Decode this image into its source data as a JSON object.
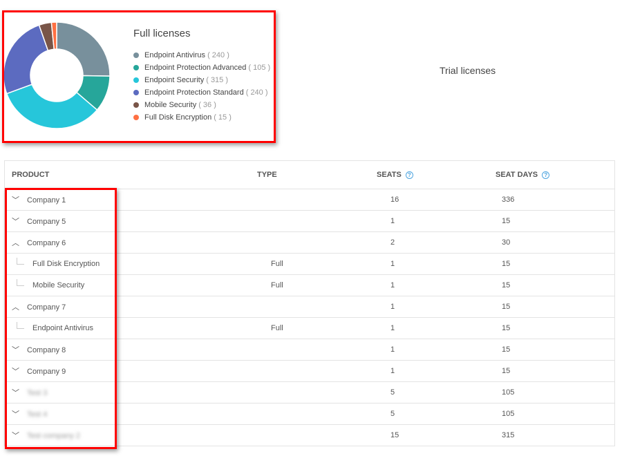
{
  "chart_data": {
    "type": "pie",
    "title": "Full licenses",
    "donut": true,
    "slices": [
      {
        "name": "Endpoint Antivirus",
        "value": 240,
        "color": "#78909c"
      },
      {
        "name": "Endpoint Protection Advanced",
        "value": 105,
        "color": "#26a69a"
      },
      {
        "name": "Endpoint Security",
        "value": 315,
        "color": "#26c6da"
      },
      {
        "name": "Endpoint Protection Standard",
        "value": 240,
        "color": "#5c6bc0"
      },
      {
        "name": "Mobile Security",
        "value": 36,
        "color": "#795548"
      },
      {
        "name": "Full Disk Encryption",
        "value": 15,
        "color": "#ff7043"
      }
    ],
    "legend": "right"
  },
  "legend_counts": [
    "( 240 )",
    "( 105 )",
    "( 315 )",
    "( 240 )",
    "( 36 )",
    "( 15 )"
  ],
  "trial_title": "Trial licenses",
  "table": {
    "headers": {
      "product": "PRODUCT",
      "type": "TYPE",
      "seats": "SEATS",
      "seat_days": "SEAT DAYS",
      "help": "?"
    },
    "rows": [
      {
        "kind": "parent",
        "expanded": false,
        "product": "Company 1",
        "type": "",
        "seats": "16",
        "seat_days": "336"
      },
      {
        "kind": "parent",
        "expanded": false,
        "product": "Company 5",
        "type": "",
        "seats": "1",
        "seat_days": "15"
      },
      {
        "kind": "parent",
        "expanded": true,
        "product": "Company 6",
        "type": "",
        "seats": "2",
        "seat_days": "30"
      },
      {
        "kind": "child",
        "product": "Full Disk Encryption",
        "type": "Full",
        "seats": "1",
        "seat_days": "15"
      },
      {
        "kind": "child",
        "product": "Mobile Security",
        "type": "Full",
        "seats": "1",
        "seat_days": "15"
      },
      {
        "kind": "parent",
        "expanded": true,
        "product": "Company 7",
        "type": "",
        "seats": "1",
        "seat_days": "15"
      },
      {
        "kind": "child",
        "product": "Endpoint Antivirus",
        "type": "Full",
        "seats": "1",
        "seat_days": "15"
      },
      {
        "kind": "parent",
        "expanded": false,
        "product": "Company 8",
        "type": "",
        "seats": "1",
        "seat_days": "15"
      },
      {
        "kind": "parent",
        "expanded": false,
        "product": "Company 9",
        "type": "",
        "seats": "1",
        "seat_days": "15"
      },
      {
        "kind": "parent",
        "expanded": false,
        "blurred": true,
        "product": "Test 3",
        "type": "",
        "seats": "5",
        "seat_days": "105"
      },
      {
        "kind": "parent",
        "expanded": false,
        "blurred": true,
        "product": "Test 4",
        "type": "",
        "seats": "5",
        "seat_days": "105"
      },
      {
        "kind": "parent",
        "expanded": false,
        "blurred": true,
        "product": "Test company 2",
        "type": "",
        "seats": "15",
        "seat_days": "315"
      }
    ]
  },
  "annotation_color": "#ff0000"
}
